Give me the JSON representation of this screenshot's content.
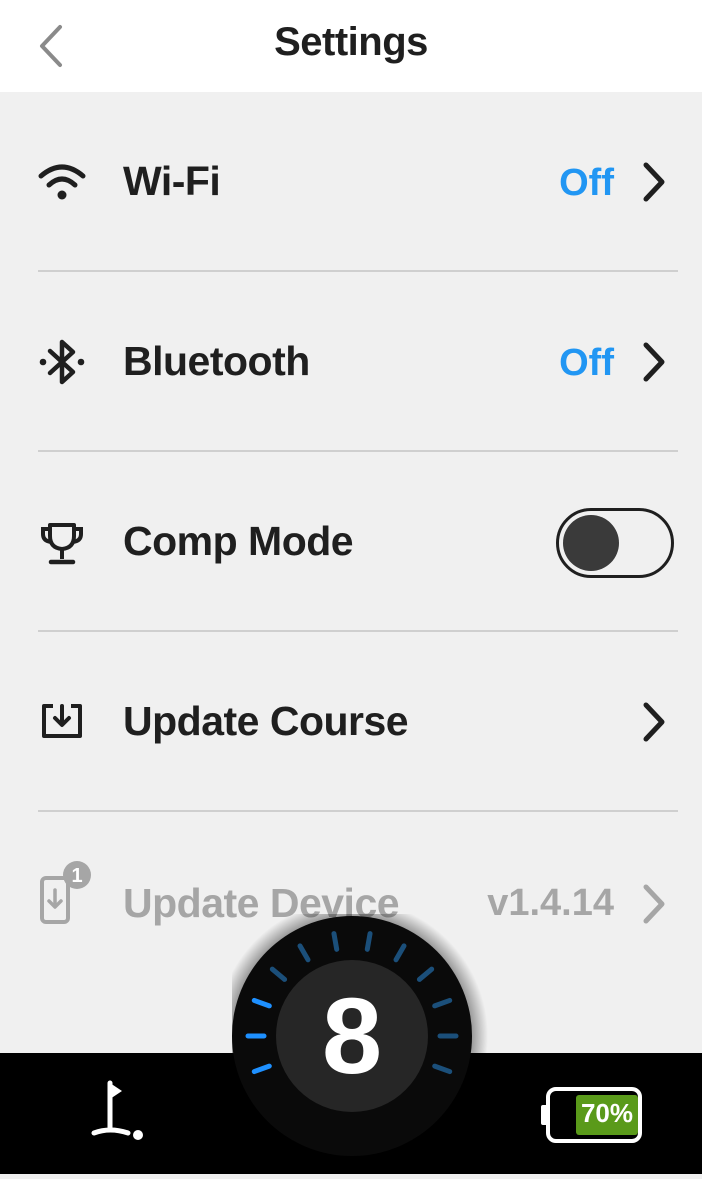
{
  "header": {
    "title": "Settings",
    "back_icon": "chevron-left-icon"
  },
  "rows": [
    {
      "label": "Wi-Fi",
      "value": "Off",
      "icon": "wifi-icon",
      "control": "chevron",
      "enabled": true
    },
    {
      "label": "Bluetooth",
      "value": "Off",
      "icon": "bluetooth-icon",
      "control": "chevron",
      "enabled": true
    },
    {
      "label": "Comp Mode",
      "icon": "trophy-icon",
      "control": "toggle",
      "toggle_on": false,
      "enabled": true
    },
    {
      "label": "Update Course",
      "icon": "download-box-icon",
      "control": "chevron",
      "enabled": true
    },
    {
      "label": "Update Device",
      "value": "v1.4.14",
      "icon": "device-update-icon",
      "badge": "1",
      "control": "chevron",
      "enabled": false
    }
  ],
  "dial": {
    "hole_number": "8",
    "tick_color": "#1e90ff"
  },
  "bottom_bar": {
    "left_icon": "golf-flag-icon",
    "battery_percent": "70%",
    "battery_level": 0.7,
    "battery_color": "#5a9a1a"
  },
  "colors": {
    "accent": "#2196f3",
    "text": "#1f1f1f",
    "disabled_text": "#a6a6a6",
    "background": "#f0f0f0"
  }
}
